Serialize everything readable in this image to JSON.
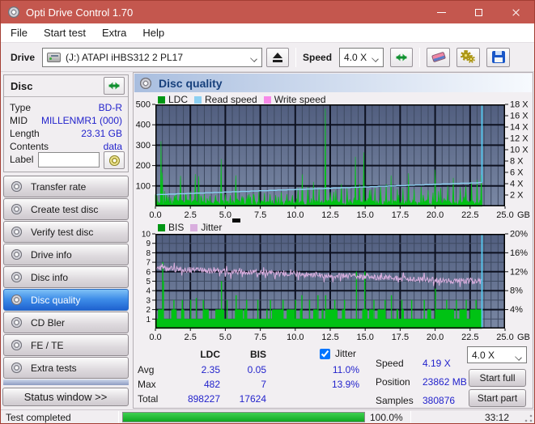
{
  "window": {
    "title": "Opti Drive Control 1.70"
  },
  "icons": {
    "app": "cd-disc",
    "drive": "optical-drive",
    "eject": "eject",
    "refresh": "sync-arrows",
    "erase": "eraser",
    "settings": "gears",
    "save": "floppy-disk",
    "disc_refresh": "sync-arrows",
    "label_browse": "cd-disc",
    "header": "cd-disc",
    "sidebar_item": "cd-disc"
  },
  "menu": {
    "items": [
      "File",
      "Start test",
      "Extra",
      "Help"
    ]
  },
  "toolbar": {
    "drive_label": "Drive",
    "drive_value": "(J:)   ATAPI iHBS312   2 PL17",
    "speed_label": "Speed",
    "speed_value": "4.0 X"
  },
  "disc_panel": {
    "title": "Disc",
    "rows": [
      {
        "label": "Type",
        "value": "BD-R"
      },
      {
        "label": "MID",
        "value": "MILLENMR1 (000)"
      },
      {
        "label": "Length",
        "value": "23.31 GB"
      },
      {
        "label": "Contents",
        "value": "data"
      }
    ],
    "label_row": {
      "label": "Label",
      "value": ""
    }
  },
  "sidebar": {
    "buttons": [
      {
        "label": "Transfer rate"
      },
      {
        "label": "Create test disc"
      },
      {
        "label": "Verify test disc"
      },
      {
        "label": "Drive info"
      },
      {
        "label": "Disc info"
      },
      {
        "label": "Disc quality"
      },
      {
        "label": "CD Bler"
      },
      {
        "label": "FE / TE"
      },
      {
        "label": "Extra tests"
      }
    ],
    "active_index": 5,
    "status_window_label": "Status window >>"
  },
  "main": {
    "header_title": "Disc quality"
  },
  "stats": {
    "columns": {
      "ldc": "LDC",
      "bis": "BIS"
    },
    "jitter": {
      "label": "Jitter",
      "checked": true
    },
    "rows": [
      {
        "label": "Avg",
        "ldc": "2.35",
        "bis": "0.05",
        "jitter": "11.0%"
      },
      {
        "label": "Max",
        "ldc": "482",
        "bis": "7",
        "jitter": "13.9%"
      },
      {
        "label": "Total",
        "ldc": "898227",
        "bis": "17624",
        "jitter": ""
      }
    ],
    "info": [
      {
        "label": "Speed",
        "value": "4.19 X"
      },
      {
        "label": "Position",
        "value": "23862 MB"
      },
      {
        "label": "Samples",
        "value": "380876"
      }
    ],
    "speed_select": "4.0 X",
    "start_full_label": "Start full",
    "start_part_label": "Start part"
  },
  "statusbar": {
    "text": "Test completed",
    "percent_label": "100.0%",
    "percent_value": 100,
    "time": "33:12"
  },
  "chart_data": [
    {
      "type": "line",
      "title": "Disc quality - LDC / Read speed",
      "legend": [
        {
          "label": "LDC",
          "color": "#009614"
        },
        {
          "label": "Read speed",
          "color": "#8dd0f2"
        },
        {
          "label": "Write speed",
          "color": "#f78ae8"
        }
      ],
      "x_axis": {
        "min": 0,
        "max": 25,
        "major_step": 2.5,
        "minor_step": 0.5,
        "unit": "GB",
        "tick_labels": [
          "0.0",
          "2.5",
          "5.0",
          "7.5",
          "10.0",
          "12.5",
          "15.0",
          "17.5",
          "20.0",
          "22.5",
          "25.0"
        ]
      },
      "y_left": {
        "min": 0,
        "max": 500,
        "tick_labels": [
          "100",
          "200",
          "300",
          "400",
          "500"
        ]
      },
      "y_right": {
        "min": 0,
        "max": 18,
        "tick_labels": [
          "2 X",
          "4 X",
          "6 X",
          "8 X",
          "10 X",
          "12 X",
          "14 X",
          "16 X",
          "18 X"
        ]
      },
      "grid_h": {
        "minor": null,
        "major": 100
      },
      "data_end_gb": 23.35,
      "series": [
        {
          "name": "LDC",
          "kind": "spikes",
          "axis": "left",
          "color": "#00c214",
          "baseline": {
            "min": 4,
            "max": 32,
            "bump_chance": 0.12,
            "bump_max": 55,
            "seed": 7
          },
          "spikes": [
            [
              0.1,
              60
            ],
            [
              0.38,
              320
            ],
            [
              0.5,
              165
            ],
            [
              0.8,
              60
            ],
            [
              1.1,
              42
            ],
            [
              1.45,
              52
            ],
            [
              1.8,
              150
            ],
            [
              2.15,
              60
            ],
            [
              2.5,
              75
            ],
            [
              2.85,
              158
            ],
            [
              3.1,
              148
            ],
            [
              3.5,
              60
            ],
            [
              3.9,
              52
            ],
            [
              4.3,
              55
            ],
            [
              4.68,
              232
            ],
            [
              5.0,
              60
            ],
            [
              5.35,
              55
            ],
            [
              5.75,
              152
            ],
            [
              6.2,
              50
            ],
            [
              6.6,
              55
            ],
            [
              7.0,
              60
            ],
            [
              7.4,
              70
            ],
            [
              7.8,
              65
            ],
            [
              8.2,
              60
            ],
            [
              8.6,
              55
            ],
            [
              9.0,
              70
            ],
            [
              9.4,
              60
            ],
            [
              9.8,
              55
            ],
            [
              10.2,
              90
            ],
            [
              10.5,
              157
            ],
            [
              10.9,
              95
            ],
            [
              11.3,
              120
            ],
            [
              11.7,
              90
            ],
            [
              12.15,
              480
            ],
            [
              12.5,
              70
            ],
            [
              12.9,
              80
            ],
            [
              13.3,
              110
            ],
            [
              13.7,
              90
            ],
            [
              14.32,
              243
            ],
            [
              14.6,
              110
            ],
            [
              14.92,
              265
            ],
            [
              15.3,
              80
            ],
            [
              15.7,
              90
            ],
            [
              16.1,
              100
            ],
            [
              16.5,
              110
            ],
            [
              16.85,
              152
            ],
            [
              17.3,
              85
            ],
            [
              17.7,
              90
            ],
            [
              18.1,
              162
            ],
            [
              18.5,
              85
            ],
            [
              19.0,
              95
            ],
            [
              19.5,
              80
            ],
            [
              20.0,
              180
            ],
            [
              20.4,
              90
            ],
            [
              20.9,
              100
            ],
            [
              21.3,
              140
            ],
            [
              21.8,
              95
            ],
            [
              22.2,
              100
            ],
            [
              22.6,
              120
            ],
            [
              23.0,
              130
            ],
            [
              23.3,
              155
            ]
          ]
        },
        {
          "name": "Read speed",
          "kind": "line",
          "axis": "right",
          "color": "#8dd0f2",
          "start": 2.05,
          "end": 4.19,
          "quantize": 0.06
        },
        {
          "name": "End marker",
          "kind": "vline",
          "color": "#55c8f0",
          "x": 23.35,
          "from_right_value": 4.19
        }
      ],
      "plot": {
        "bg_top": "#515e7f",
        "bg_bottom": "#7a88a4",
        "grid_minor": "#3e4a62",
        "grid_major": "#0d1120",
        "border": "#000000"
      }
    },
    {
      "type": "line",
      "title": "Disc quality - BIS / Jitter",
      "legend": [
        {
          "label": "BIS",
          "color": "#009614"
        },
        {
          "label": "Jitter",
          "color": "#d9aede"
        }
      ],
      "x_axis": {
        "min": 0,
        "max": 25,
        "major_step": 2.5,
        "minor_step": 0.5,
        "unit": "GB",
        "tick_labels": [
          "0.0",
          "2.5",
          "5.0",
          "7.5",
          "10.0",
          "12.5",
          "15.0",
          "17.5",
          "20.0",
          "22.5",
          "25.0"
        ]
      },
      "y_left": {
        "min": 0,
        "max": 10,
        "tick_labels": [
          "1",
          "2",
          "3",
          "4",
          "5",
          "6",
          "7",
          "8",
          "9",
          "10"
        ]
      },
      "y_right": {
        "min": 0,
        "max": 20,
        "tick_labels": [
          "4%",
          "8%",
          "12%",
          "16%",
          "20%"
        ]
      },
      "grid_h": {
        "minor": 1,
        "major": 2
      },
      "data_end_gb": 23.35,
      "series": [
        {
          "name": "BIS",
          "kind": "bars",
          "axis": "left",
          "color": "#00c214",
          "baseline": {
            "levels": [
              1,
              2
            ],
            "persist": 0.78,
            "seed": 11
          },
          "spikes": [
            [
              0.5,
              7
            ],
            [
              0.55,
              5
            ],
            [
              1.3,
              3
            ],
            [
              1.9,
              3
            ],
            [
              2.5,
              3
            ],
            [
              2.9,
              3.2
            ],
            [
              3.4,
              3
            ],
            [
              4.7,
              5
            ],
            [
              5.1,
              3
            ],
            [
              5.75,
              3.5
            ],
            [
              6.5,
              3
            ],
            [
              7.3,
              3
            ],
            [
              8.2,
              3
            ],
            [
              9.1,
              3
            ],
            [
              10.0,
              3
            ],
            [
              10.45,
              3.5
            ],
            [
              11.0,
              3
            ],
            [
              11.6,
              3.5
            ],
            [
              12.15,
              3.5
            ],
            [
              12.8,
              3
            ],
            [
              13.5,
              3
            ],
            [
              14.35,
              6
            ],
            [
              14.95,
              6
            ],
            [
              15.6,
              3
            ],
            [
              16.4,
              3
            ],
            [
              16.85,
              3.5
            ],
            [
              17.6,
              3
            ],
            [
              18.3,
              3
            ],
            [
              19.2,
              3
            ],
            [
              20.0,
              4.2
            ],
            [
              20.8,
              3
            ],
            [
              21.5,
              3
            ],
            [
              22.2,
              3
            ],
            [
              22.9,
              3
            ]
          ]
        },
        {
          "name": "Jitter",
          "kind": "noisyline",
          "axis": "left",
          "color": "#d9aede",
          "start": 6.35,
          "end": 4.95,
          "noise": 0.3,
          "seed": 3
        },
        {
          "name": "End marker",
          "kind": "vline-full",
          "color": "#55c8f0",
          "x": 23.35
        }
      ],
      "plot": {
        "bg_top": "#515e7f",
        "bg_bottom": "#7a88a4",
        "grid_minor": "#3e4a62",
        "grid_major": "#0d1120",
        "border": "#000000"
      }
    }
  ]
}
